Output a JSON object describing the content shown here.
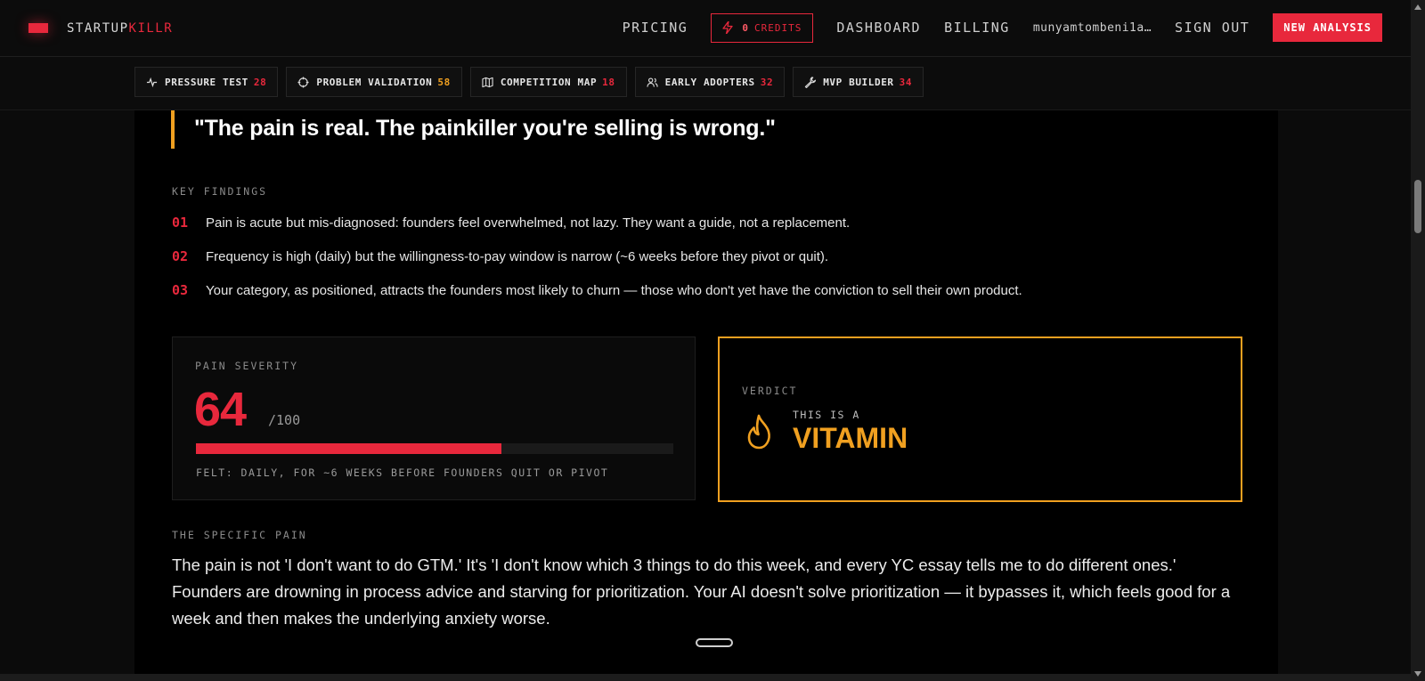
{
  "brand": {
    "name_main": "STARTUP",
    "name_accent": "KILLR"
  },
  "nav": {
    "pricing": "PRICING",
    "credits_count": "0",
    "credits_label": "CREDITS",
    "dashboard": "DASHBOARD",
    "billing": "BILLING",
    "user": "munyamtombeni1a…",
    "sign_out": "SIGN OUT",
    "new_analysis": "NEW ANALYSIS"
  },
  "tabs": [
    {
      "label": "PRESSURE TEST",
      "score": "28",
      "icon": "activity-icon"
    },
    {
      "label": "PROBLEM VALIDATION",
      "score": "58",
      "icon": "crosshair-icon"
    },
    {
      "label": "COMPETITION MAP",
      "score": "18",
      "icon": "map-icon"
    },
    {
      "label": "EARLY ADOPTERS",
      "score": "32",
      "icon": "users-icon"
    },
    {
      "label": "MVP BUILDER",
      "score": "34",
      "icon": "wrench-icon"
    }
  ],
  "quote": "\"The pain is real. The painkiller you're selling is wrong.\"",
  "key_findings": {
    "label": "KEY FINDINGS",
    "items": [
      {
        "num": "01",
        "text": "Pain is acute but mis-diagnosed: founders feel overwhelmed, not lazy. They want a guide, not a replacement."
      },
      {
        "num": "02",
        "text": "Frequency is high (daily) but the willingness-to-pay window is narrow (~6 weeks before they pivot or quit)."
      },
      {
        "num": "03",
        "text": "Your category, as positioned, attracts the founders most likely to churn — those who don't yet have the conviction to sell their own product."
      }
    ]
  },
  "pain_severity": {
    "label": "PAIN SEVERITY",
    "score": "64",
    "out_of": "/100",
    "fill_percent": 64,
    "felt": "FELT: DAILY, FOR ~6 WEEKS BEFORE FOUNDERS QUIT OR PIVOT"
  },
  "verdict": {
    "label": "VERDICT",
    "prefix": "THIS IS A",
    "word": "VITAMIN",
    "icon": "flame-icon"
  },
  "specific_pain": {
    "label": "THE SPECIFIC PAIN",
    "text": "The pain is not 'I don't want to do GTM.' It's 'I don't know which 3 things to do this week, and every YC essay tells me to do different ones.' Founders are drowning in process advice and starving for prioritization. Your AI doesn't solve prioritization — it bypasses it, which feels good for a week and then makes the underlying anxiety worse."
  },
  "colors": {
    "accent_red": "#e8283c",
    "accent_amber": "#f0a020",
    "background": "#000000"
  }
}
